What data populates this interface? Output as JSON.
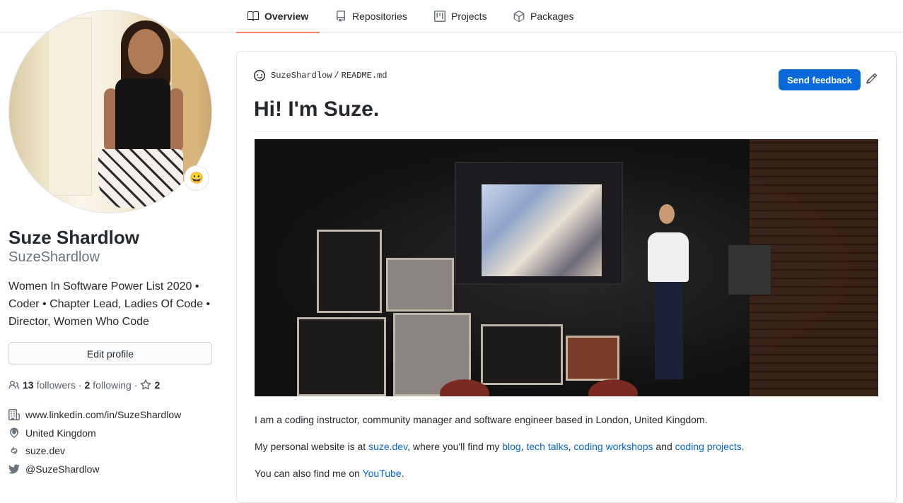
{
  "nav": {
    "tabs": [
      {
        "label": "Overview",
        "icon": "book-icon",
        "selected": true
      },
      {
        "label": "Repositories",
        "icon": "repo-icon",
        "selected": false
      },
      {
        "label": "Projects",
        "icon": "project-icon",
        "selected": false
      },
      {
        "label": "Packages",
        "icon": "package-icon",
        "selected": false
      }
    ]
  },
  "profile": {
    "status_emoji": "😀",
    "full_name": "Suze Shardlow",
    "username": "SuzeShardlow",
    "bio": "Women In Software Power List 2020 • Coder • Chapter Lead, Ladies Of Code • Director, Women Who Code",
    "edit_button": "Edit profile",
    "followers_count": "13",
    "followers_label": "followers",
    "following_count": "2",
    "following_label": "following",
    "stars_count": "2",
    "separator": "·",
    "organization": "www.linkedin.com/in/SuzeShardlow",
    "location": "United Kingdom",
    "website": "suze.dev",
    "twitter": "@SuzeShardlow"
  },
  "readme": {
    "path_user": "SuzeShardlow",
    "path_sep": "/",
    "path_file": "README.md",
    "feedback_button": "Send feedback",
    "heading": "Hi! I'm Suze.",
    "p1": "I am a coding instructor, community manager and software engineer based in London, United Kingdom.",
    "p2": {
      "t1": "My personal website is at ",
      "link1": "suze.dev",
      "t2": ", where you'll find my ",
      "link2": "blog",
      "t3": ", ",
      "link3": "tech talks",
      "t4": ", ",
      "link4": "coding workshops",
      "t5": " and ",
      "link5": "coding projects",
      "t6": "."
    },
    "p3": {
      "t1": "You can also find me on ",
      "link1": "YouTube",
      "t2": "."
    }
  },
  "colors": {
    "accent_blue": "#0969da",
    "link_blue": "#0366d6",
    "tab_underline": "#f9826c",
    "text": "#24292e",
    "muted": "#6a737d"
  }
}
